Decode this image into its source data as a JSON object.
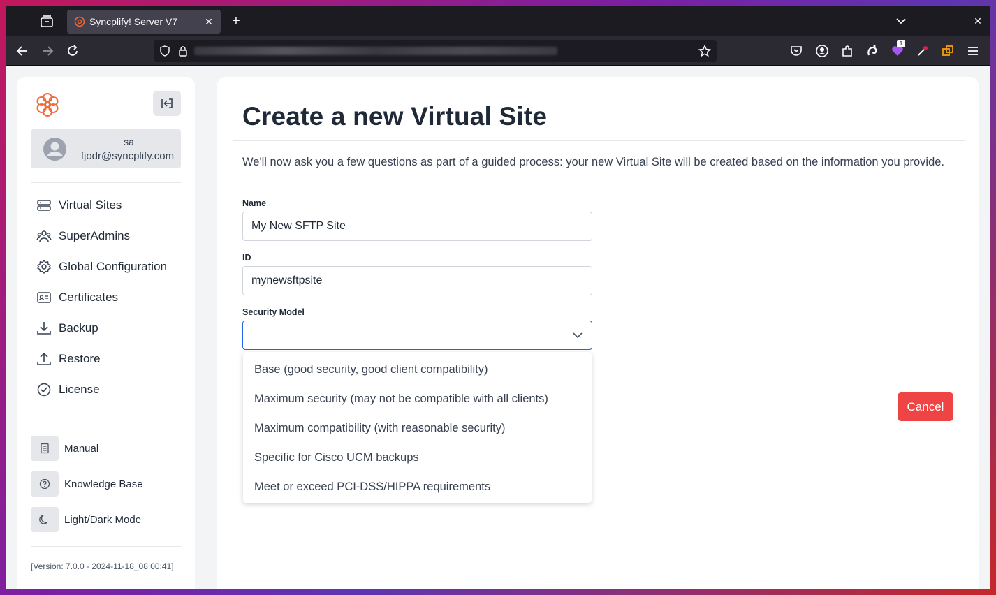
{
  "browser": {
    "tab_title": "Syncplify! Server V7",
    "extension_badge": "1"
  },
  "sidebar": {
    "user": {
      "name": "sa",
      "email": "fjodr@syncplify.com"
    },
    "nav_items": [
      {
        "label": "Virtual Sites",
        "icon": "server-icon"
      },
      {
        "label": "SuperAdmins",
        "icon": "users-icon"
      },
      {
        "label": "Global Configuration",
        "icon": "gear-icon"
      },
      {
        "label": "Certificates",
        "icon": "id-card-icon"
      },
      {
        "label": "Backup",
        "icon": "download-icon"
      },
      {
        "label": "Restore",
        "icon": "upload-icon"
      },
      {
        "label": "License",
        "icon": "check-badge-icon"
      }
    ],
    "util_items": [
      {
        "label": "Manual",
        "icon": "document-icon"
      },
      {
        "label": "Knowledge Base",
        "icon": "question-icon"
      },
      {
        "label": "Light/Dark Mode",
        "icon": "moon-icon"
      }
    ],
    "version": "[Version: 7.0.0 - 2024-11-18_08:00:41]"
  },
  "main": {
    "title": "Create a new Virtual Site",
    "intro": "We'll now ask you a few questions as part of a guided process: your new Virtual Site will be created based on the information you provide.",
    "fields": {
      "name": {
        "label": "Name",
        "value": "My New SFTP Site"
      },
      "id": {
        "label": "ID",
        "value": "mynewsftpsite"
      },
      "security_model": {
        "label": "Security Model",
        "value": "",
        "options": [
          "Base (good security, good client compatibility)",
          "Maximum security (may not be compatible with all clients)",
          "Maximum compatibility (with reasonable security)",
          "Specific for Cisco UCM backups",
          "Meet or exceed PCI-DSS/HIPPA requirements"
        ]
      }
    },
    "cancel_label": "Cancel"
  },
  "colors": {
    "accent_blue": "#2563eb",
    "cancel_red": "#ef4444",
    "logo_orange": "#f26b3a"
  }
}
